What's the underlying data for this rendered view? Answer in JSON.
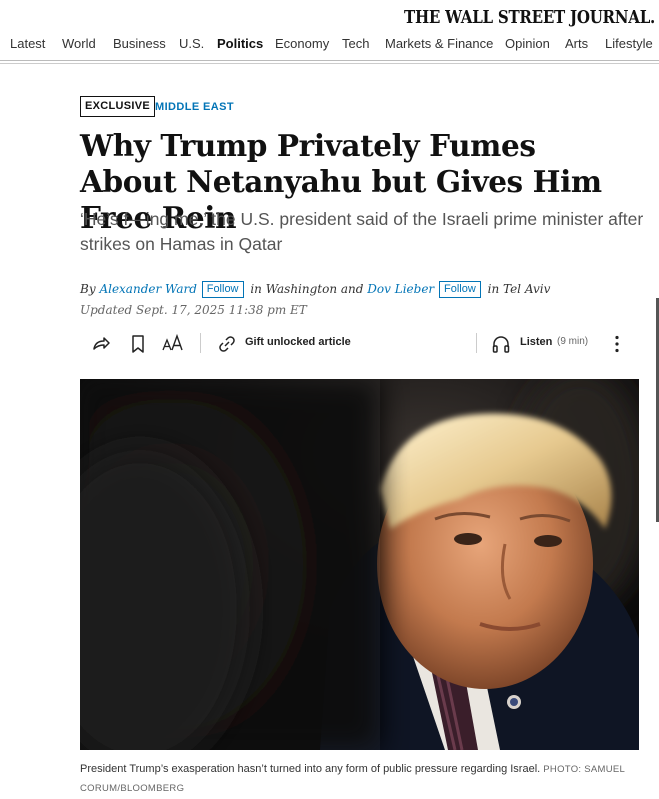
{
  "masthead": {
    "logo": "THE WALL STREET JOURNAL."
  },
  "nav": {
    "items": [
      "Latest",
      "World",
      "Business",
      "U.S.",
      "Politics",
      "Economy",
      "Tech",
      "Markets & Finance",
      "Opinion",
      "Arts",
      "Lifestyle"
    ],
    "active": "Politics"
  },
  "article": {
    "tag": "EXCLUSIVE",
    "section": "MIDDLE EAST",
    "headline": "Why Trump Privately Fumes About Netanyahu but Gives Him Free Rein",
    "dek": "‘He’s f—ing me,’ the U.S. president said of the Israeli prime minister after strikes on Hamas in Qatar",
    "byline": {
      "by": "By",
      "author1": "Alexander Ward",
      "location1": "in Washington and",
      "author2": "Dov Lieber",
      "location2": "in Tel Aviv",
      "follow_label": "Follow"
    },
    "updated": "Updated Sept. 17, 2025 11:38 pm ET"
  },
  "toolbar": {
    "gift_label": "Gift unlocked article",
    "listen_label": "Listen",
    "listen_duration": "(9 min)"
  },
  "photo": {
    "caption": "President Trump’s exasperation hasn’t turned into any form of public pressure regarding Israel.",
    "credit": "PHOTO: SAMUEL CORUM/BLOOMBERG"
  },
  "colors": {
    "accent": "#0274b6",
    "text": "#111111",
    "muted": "#555555"
  }
}
